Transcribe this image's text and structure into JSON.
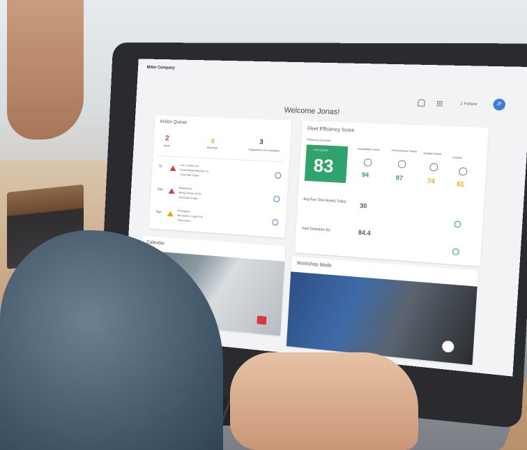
{
  "app": {
    "brand": "Miller Company"
  },
  "header": {
    "user_name": "J. Fortune",
    "avatar_initials": "JF"
  },
  "welcome": "Welcome Jonas!",
  "action_queue": {
    "title": "Action Queue",
    "counters": [
      {
        "value": "2",
        "label": "Alerts",
        "color": "#d9363e"
      },
      {
        "value": "0",
        "label": "Warnings",
        "color": "#f0a500"
      },
      {
        "value": "3",
        "label": "Suggestions to investigate",
        "color": "#444444"
      }
    ],
    "items": [
      {
        "day": "Th",
        "level": "alert",
        "line1": "Line 1 (Kpi) Low",
        "line2": "Panel Mixing Machine 01",
        "line3": "Trend last 3 days"
      },
      {
        "day": "Sun",
        "level": "alert",
        "line1": "Warehouse",
        "line2": "Mixing Vessel 2F/2L",
        "line3": "Trend last 3 days"
      },
      {
        "day": "Sun",
        "level": "warning",
        "line1": "Packaging",
        "line2": "Mix Kettle 2 Cycle 105",
        "line3": "Trend Index"
      }
    ]
  },
  "fleet": {
    "title": "Fleet Efficiency Score",
    "subtitle": "Efficiency Overview",
    "score_label": "Last Quarter",
    "score": "83",
    "metrics": [
      {
        "label": "Availability Factor",
        "value": "94",
        "color": "#2fa36b"
      },
      {
        "label": "Performance Factor",
        "value": "97",
        "color": "#2fa36b"
      },
      {
        "label": "Quality Factor",
        "value": "74",
        "color": "#f0a500"
      },
      {
        "label": "Overall",
        "value": "61",
        "color": "#f0a500"
      }
    ],
    "rows": [
      {
        "label": "Avg Run Time Assets Today",
        "value": "30"
      },
      {
        "label": "Total Downtime (h)",
        "value": "84.4"
      }
    ]
  },
  "cards": [
    {
      "title": "Calendar"
    },
    {
      "title": "Workshop Mode"
    }
  ]
}
